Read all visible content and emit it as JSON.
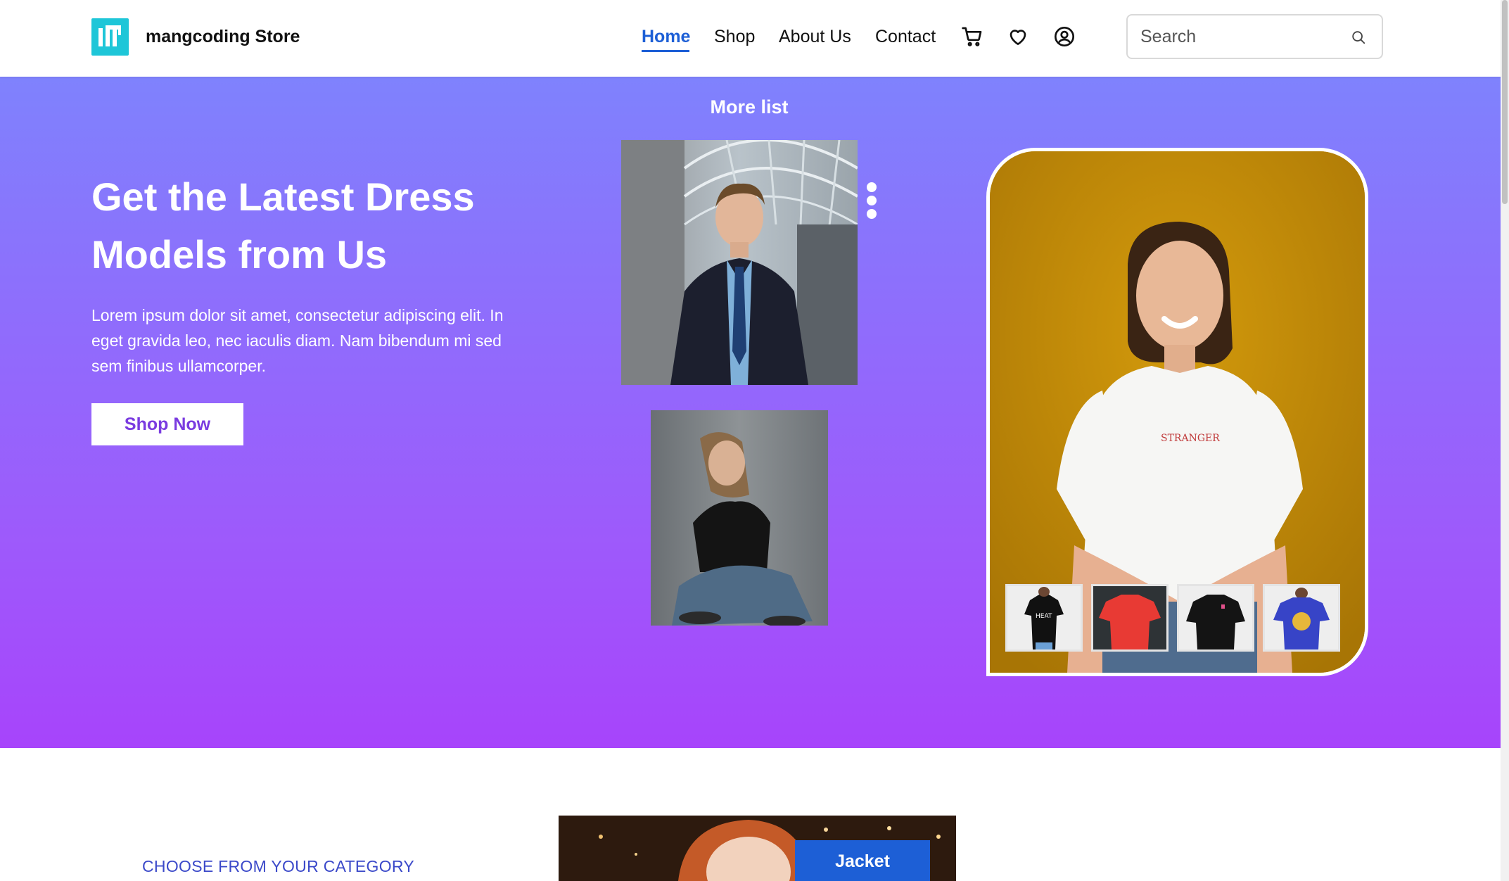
{
  "header": {
    "brand": "mangcoding Store",
    "logo_icon": "mangcoding-logo-icon",
    "logo_color": "#1ec6d8",
    "nav": [
      {
        "label": "Home",
        "active": true
      },
      {
        "label": "Shop",
        "active": false
      },
      {
        "label": "About Us",
        "active": false
      },
      {
        "label": "Contact",
        "active": false
      }
    ],
    "icons": [
      "cart-icon",
      "heart-icon",
      "user-icon"
    ],
    "search": {
      "placeholder": "Search",
      "value": "",
      "icon": "search-icon"
    },
    "active_color": "#1d5fd6"
  },
  "hero": {
    "title": "Get the Latest Dress Models from Us",
    "description": "Lorem ipsum dolor sit amet, consectetur adipiscing elit. In eget gravida leo, nec iaculis diam. Nam bibendum mi sed sem finibus ullamcorper.",
    "cta_label": "Shop Now",
    "more_list_label": "More list",
    "gradient_top": "#7f82fd",
    "gradient_bottom": "#a744fb",
    "photos": [
      "man-in-suit-photo",
      "woman-sitting-photo"
    ],
    "featured_photo": "woman-white-tshirt-photo",
    "thumbnails": [
      "black-tshirt-thumb",
      "red-tshirt-thumb",
      "black-tshirt-2-thumb",
      "blue-tshirt-thumb"
    ]
  },
  "category": {
    "label": "CHOOSE FROM YOUR CATEGORY",
    "card_tag": "Jacket",
    "tag_color": "#1d5fd6"
  }
}
